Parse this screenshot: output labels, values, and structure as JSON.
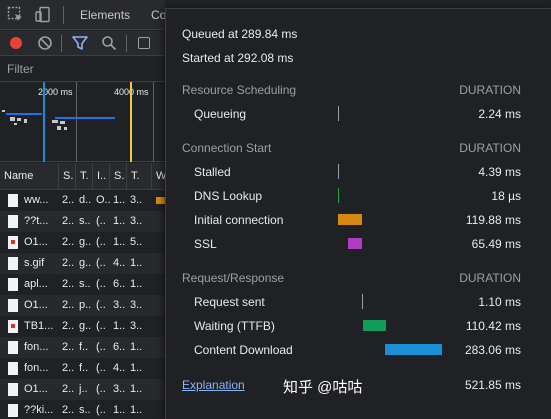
{
  "devtools": {
    "tabs": {
      "elements": "Elements",
      "console_partial": "Co"
    },
    "filter_placeholder": "Filter",
    "overview_ticks": [
      "2000 ms",
      "4000 ms"
    ],
    "columns": [
      "Name",
      "S.",
      "T.",
      "I..",
      "S.",
      "T.",
      "W"
    ],
    "rows": [
      {
        "name": "ww...",
        "c1": "2..",
        "c2": "d..",
        "c3": "O..",
        "c4": "1..",
        "c5": "3..",
        "icon": "document"
      },
      {
        "name": "??t...",
        "c1": "2..",
        "c2": "s..",
        "c3": "(..",
        "c4": "1..",
        "c5": "3..",
        "icon": "document"
      },
      {
        "name": "O1...",
        "c1": "2..",
        "c2": "g..",
        "c3": "(..",
        "c4": "1..",
        "c5": "5..",
        "icon": "image-red"
      },
      {
        "name": "s.gif",
        "c1": "2..",
        "c2": "g..",
        "c3": "(..",
        "c4": "4..",
        "c5": "1..",
        "icon": "document"
      },
      {
        "name": "apl...",
        "c1": "2..",
        "c2": "s..",
        "c3": "(..",
        "c4": "6..",
        "c5": "1..",
        "icon": "document"
      },
      {
        "name": "O1...",
        "c1": "2..",
        "c2": "p..",
        "c3": "(..",
        "c4": "3..",
        "c5": "3..",
        "icon": "document"
      },
      {
        "name": "TB1...",
        "c1": "2..",
        "c2": "g..",
        "c3": "(..",
        "c4": "1..",
        "c5": "3..",
        "icon": "image-red"
      },
      {
        "name": "fon...",
        "c1": "2..",
        "c2": "f..",
        "c3": "(..",
        "c4": "6..",
        "c5": "1..",
        "icon": "document"
      },
      {
        "name": "fon...",
        "c1": "2..",
        "c2": "f..",
        "c3": "(..",
        "c4": "4..",
        "c5": "1..",
        "icon": "document"
      },
      {
        "name": "O1...",
        "c1": "2..",
        "c2": "j..",
        "c3": "(..",
        "c4": "3..",
        "c5": "1..",
        "icon": "document"
      },
      {
        "name": "??ki...",
        "c1": "2..",
        "c2": "s..",
        "c3": "(..",
        "c4": "1..",
        "c5": "1..",
        "icon": "document"
      }
    ]
  },
  "timing": {
    "queued": "Queued at 289.84 ms",
    "started": "Started at 292.08 ms",
    "sections": [
      {
        "title": "Resource Scheduling",
        "duration_header": "DURATION",
        "items": [
          {
            "label": "Queueing",
            "value": "2.24 ms",
            "color": "#9aa0a6",
            "start": 0.0,
            "length": 0.0023
          }
        ]
      },
      {
        "title": "Connection Start",
        "duration_header": "DURATION",
        "items": [
          {
            "label": "Stalled",
            "value": "4.39 ms",
            "color": "#9aa0a6",
            "start": 0.0,
            "length": 0.0045
          },
          {
            "label": "DNS Lookup",
            "value": "18 µs",
            "color": "#1ea446",
            "start": 0.0,
            "length": 0.0
          },
          {
            "label": "Initial connection",
            "value": "119.88 ms",
            "color": "#d68910",
            "start": 0.0,
            "length": 0.23
          },
          {
            "label": "SSL",
            "value": "65.49 ms",
            "color": "#b03dc1",
            "start": 0.1,
            "length": 0.13
          }
        ]
      },
      {
        "title": "Request/Response",
        "duration_header": "DURATION",
        "items": [
          {
            "label": "Request sent",
            "value": "1.10 ms",
            "color": "#9aa0a6",
            "start": 0.23,
            "length": 0.002
          },
          {
            "label": "Waiting (TTFB)",
            "value": "110.42 ms",
            "color": "#0f9d58",
            "start": 0.24,
            "length": 0.22
          },
          {
            "label": "Content Download",
            "value": "283.06 ms",
            "color": "#1a8fd6",
            "start": 0.45,
            "length": 0.55
          }
        ]
      }
    ],
    "explanation": "Explanation",
    "total": "521.85 ms"
  },
  "watermark": "知乎 @咕咕"
}
